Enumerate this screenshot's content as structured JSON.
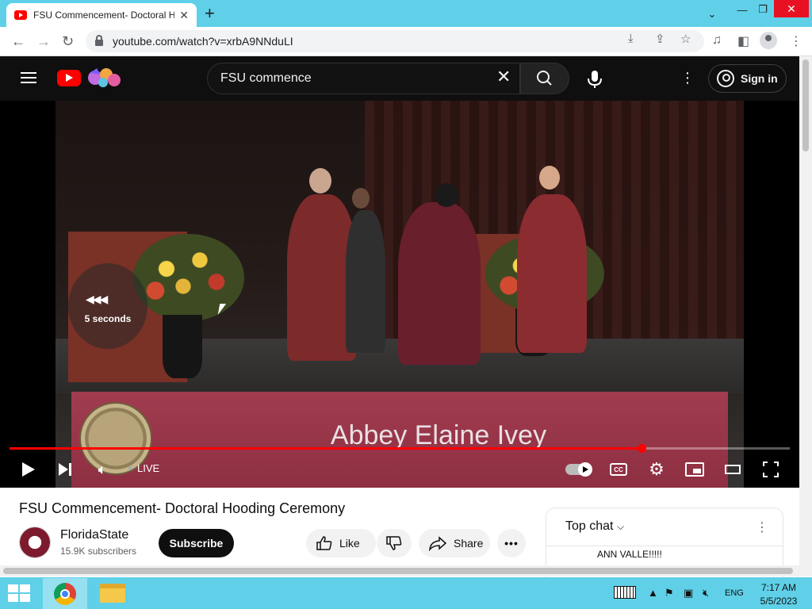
{
  "browser": {
    "tab_title": "FSU Commencement- Doctoral Hooding Ceremony - YouTube",
    "tab_close": "✕",
    "new_tab": "+",
    "url": "youtube.com/watch?v=xrbA9NNduLI",
    "window_min": "—",
    "window_max": "❐",
    "window_close": "✕",
    "chevron": "⌄",
    "icons": [
      "back-icon",
      "forward-icon",
      "reload-icon",
      "lock-icon",
      "install-icon",
      "share-icon",
      "star-icon",
      "media-icon",
      "sidepanel-icon",
      "profile-icon",
      "menu-icon"
    ]
  },
  "youtube": {
    "search_query": "FSU commence",
    "sign_in": "Sign in",
    "accent": "#ff0000"
  },
  "player": {
    "seek_hint": "5 seconds",
    "banner_name": "Abbey Elaine Ivey",
    "live_label": "LIVE",
    "cc_label": "CC",
    "progress": 0.81
  },
  "video": {
    "title": "FSU Commencement- Doctoral Hooding Ceremony",
    "channel": "FloridaState",
    "subscribers": "15.9K subscribers",
    "subscribe": "Subscribe",
    "like": "Like",
    "share": "Share"
  },
  "chat": {
    "header": "Top chat",
    "message": "ANN VALLE!!!!!"
  },
  "taskbar": {
    "language": "ENG",
    "time": "7:17 AM",
    "date": "5/5/2023"
  }
}
